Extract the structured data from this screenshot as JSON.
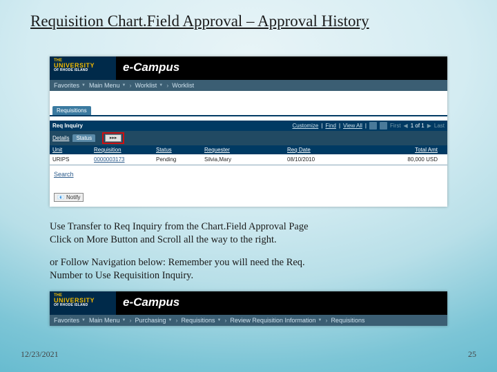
{
  "slide": {
    "title": "Requisition Chart.Field Approval – Approval History",
    "date": "12/23/2021",
    "page_number": "25"
  },
  "screenshot1": {
    "logo": {
      "line1": "THE",
      "line2": "UNIVERSITY",
      "line3": "OF RHODE ISLAND"
    },
    "ecampus": "e-Campus",
    "breadcrumb": {
      "favorites": "Favorites",
      "mainmenu": "Main Menu",
      "worklist1": "Worklist",
      "worklist2": "Worklist"
    },
    "requisitions_tab": "Requisitions",
    "reqinq_label": "Req Inquiry",
    "toolbar": {
      "customize": "Customize",
      "find": "Find",
      "viewall": "View All",
      "pager": "1 of 1",
      "first": "First",
      "last": "Last"
    },
    "subtabs": {
      "details": "Details",
      "status": "Status",
      "more": "▸▸▸"
    },
    "columns": {
      "unit": "Unit",
      "requisition": "Requisition",
      "status": "Status",
      "requester": "Requester",
      "reqdate": "Req Date",
      "totalamt": "Total Amt"
    },
    "row": {
      "unit": "URIPS",
      "requisition": "0000003173",
      "status": "Pending",
      "requester": "Silvia,Mary",
      "reqdate": "08/10/2010",
      "totalamt": "80,000 USD"
    },
    "search": "Search",
    "notify": "Notify"
  },
  "instructions": {
    "p1a": "Use Transfer to Req Inquiry from the Chart.Field Approval Page",
    "p1b": "Click on More Button and Scroll all the way to the right.",
    "p2a": "or Follow Navigation below:  Remember you will need the Req.",
    "p2b": "Number to Use Requisition Inquiry."
  },
  "screenshot2": {
    "logo": {
      "line1": "THE",
      "line2": "UNIVERSITY",
      "line3": "OF RHODE ISLAND"
    },
    "ecampus": "e-Campus",
    "breadcrumb": {
      "favorites": "Favorites",
      "mainmenu": "Main Menu",
      "purchasing": "Purchasing",
      "requisitions": "Requisitions",
      "review": "Review Requisition Information",
      "requisitions2": "Requisitions"
    }
  }
}
